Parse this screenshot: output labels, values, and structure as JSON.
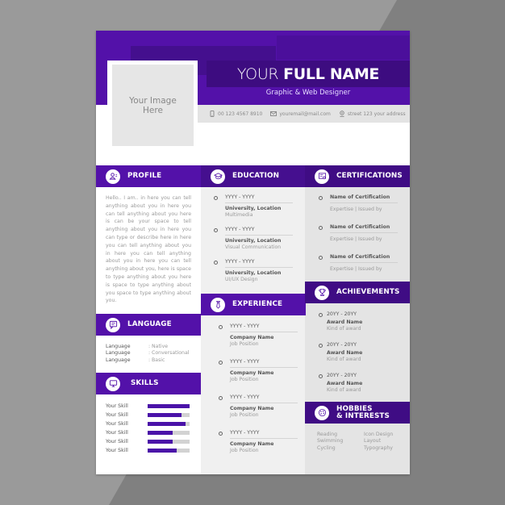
{
  "header": {
    "name_first": "YOUR",
    "name_rest": "FULL NAME",
    "subtitle": "Graphic & Web Designer",
    "photo_placeholder_line1": "Your Image",
    "photo_placeholder_line2": "Here",
    "contacts": [
      {
        "icon": "phone-icon",
        "text": "00 123 4567 8910"
      },
      {
        "icon": "mail-icon",
        "text": "youremail@mail.com"
      },
      {
        "icon": "location-pin-icon",
        "text": "street 123 your address"
      }
    ]
  },
  "colors": {
    "accent": "#5311a9",
    "accent_dark": "#450f8f",
    "accent_darkest": "#3d0c80",
    "column_mid": "#f0f0f0",
    "column_right": "#e4e4e4"
  },
  "sections": {
    "profile": {
      "title": "PROFILE",
      "icon": "user-profile-icon",
      "text": "Hello.. I am.. in here you can tell anything about you in here you can tell anything about you here is can be your space to tell anything about you in here you can type or describe here in here you can tell anything about you in here you can tell anything about you in here you can tell anything about you, here is space to type anything about you here is space to type anything about you space to type anything about you."
    },
    "language": {
      "title": "LANGUAGE",
      "icon": "chat-icon",
      "items": [
        {
          "name": "Language",
          "level": ": Native"
        },
        {
          "name": "Language",
          "level": ": Conversational"
        },
        {
          "name": "Language",
          "level": ": Basic"
        }
      ]
    },
    "skills": {
      "title": "SKILLS",
      "icon": "monitor-icon",
      "items": [
        {
          "name": "Your Skill",
          "level": 1.0
        },
        {
          "name": "Your Skill",
          "level": 0.8
        },
        {
          "name": "Your Skill",
          "level": 0.9
        },
        {
          "name": "Your Skill",
          "level": 0.6
        },
        {
          "name": "Your Skill",
          "level": 0.6
        },
        {
          "name": "Your Skill",
          "level": 0.7
        }
      ]
    },
    "education": {
      "title": "EDUCATION",
      "icon": "graduation-cap-icon",
      "items": [
        {
          "date": "YYYY - YYYY",
          "title": "University, Location",
          "sub": "Multimedia"
        },
        {
          "date": "YYYY - YYYY",
          "title": "University, Location",
          "sub": "Visual Communication"
        },
        {
          "date": "YYYY - YYYY",
          "title": "University, Location",
          "sub": "UI/UX Design"
        }
      ]
    },
    "experience": {
      "title": "EXPERIENCE",
      "icon": "necktie-icon",
      "items": [
        {
          "date": "YYYY - YYYY",
          "title": "Company Name",
          "sub": "Job Position"
        },
        {
          "date": "YYYY - YYYY",
          "title": "Company Name",
          "sub": "Job Position"
        },
        {
          "date": "YYYY - YYYY",
          "title": "Company Name",
          "sub": "Job Position"
        },
        {
          "date": "YYYY - YYYY",
          "title": "Company Name",
          "sub": "Job Position"
        }
      ]
    },
    "certifications": {
      "title": "CERTIFICATIONS",
      "icon": "certificate-icon",
      "items": [
        {
          "title": "Name of Certification",
          "sub": "Expertise | Issued by"
        },
        {
          "title": "Name of Certification",
          "sub": "Expertise | Issued by"
        },
        {
          "title": "Name of Certification",
          "sub": "Expertise | Issued by"
        }
      ]
    },
    "achievements": {
      "title": "ACHIEVEMENTS",
      "icon": "trophy-icon",
      "items": [
        {
          "date": "20YY - 20YY",
          "title": "Award Name",
          "sub": "Kind of award"
        },
        {
          "date": "20YY - 20YY",
          "title": "Award Name",
          "sub": "Kind of award"
        },
        {
          "date": "20YY - 20YY",
          "title": "Award Name",
          "sub": "Kind of award"
        }
      ]
    },
    "hobbies": {
      "title_line1": "HOBBIES",
      "title_line2": "& INTERESTS",
      "icon": "palette-icon",
      "col1": [
        "Reading",
        "Swimming",
        "Cycling"
      ],
      "col2": [
        "Icon Design",
        "Layout",
        "Typography"
      ]
    }
  }
}
